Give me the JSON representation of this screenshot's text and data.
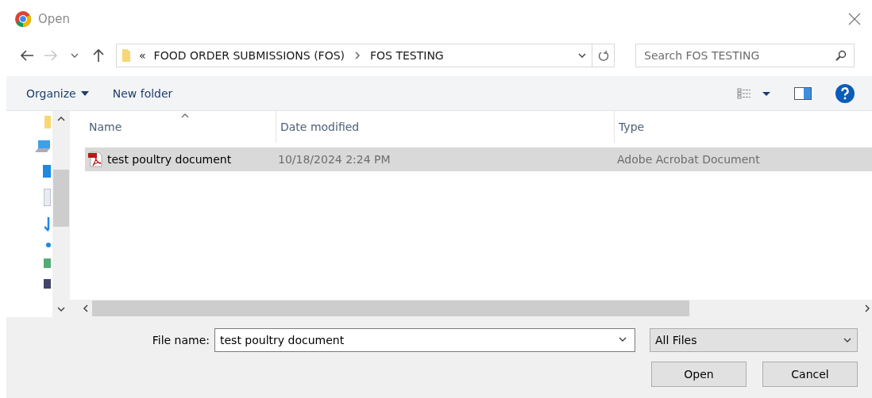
{
  "window": {
    "title": "Open"
  },
  "navigation": {
    "back_enabled": true,
    "forward_enabled": false,
    "breadcrumb": [
      {
        "label": "«"
      },
      {
        "label": "FOOD ORDER SUBMISSIONS (FOS)"
      },
      {
        "label": "FOS TESTING"
      }
    ]
  },
  "search": {
    "placeholder": "Search FOS TESTING"
  },
  "toolbar": {
    "items": [
      {
        "label": "Organize",
        "kind": "menu"
      },
      {
        "label": "New folder",
        "kind": "button"
      }
    ]
  },
  "table": {
    "columns": [
      {
        "label": "Name",
        "sorted": true
      },
      {
        "label": "Date modified",
        "sorted": false
      },
      {
        "label": "Type",
        "sorted": false
      }
    ],
    "rows": [
      {
        "name": "test poultry document",
        "date_modified": "10/18/2024 2:24 PM",
        "type": "Adobe Acrobat Document",
        "selected": true
      }
    ]
  },
  "file_name": {
    "label": "File name:",
    "value": "test poultry document"
  },
  "file_type": {
    "value": "All Files"
  },
  "buttons": [
    {
      "label": "Open"
    },
    {
      "label": "Cancel"
    }
  ]
}
